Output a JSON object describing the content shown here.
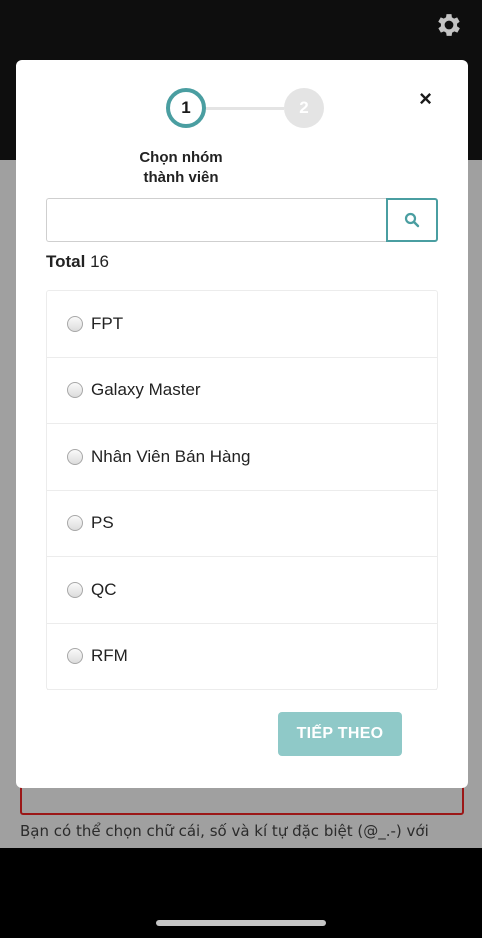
{
  "background": {
    "hint_text": "Bạn có thể chọn chữ cái, số và kí tự đặc biệt (@_.-) với"
  },
  "modal": {
    "close_label": "×",
    "steps": [
      "1",
      "2"
    ],
    "step_label_line1": "Chọn nhóm",
    "step_label_line2": "thành viên",
    "search": {
      "value": "",
      "placeholder": ""
    },
    "total_label": "Total",
    "total_count": "16",
    "groups": [
      "FPT",
      "Galaxy Master",
      "Nhân Viên Bán Hàng",
      "PS",
      "QC",
      "RFM"
    ],
    "next_button": "TIẾP THEO"
  },
  "colors": {
    "accent": "#4a9ea1",
    "button": "#8fc9c8",
    "error_border": "#b71c1c"
  }
}
